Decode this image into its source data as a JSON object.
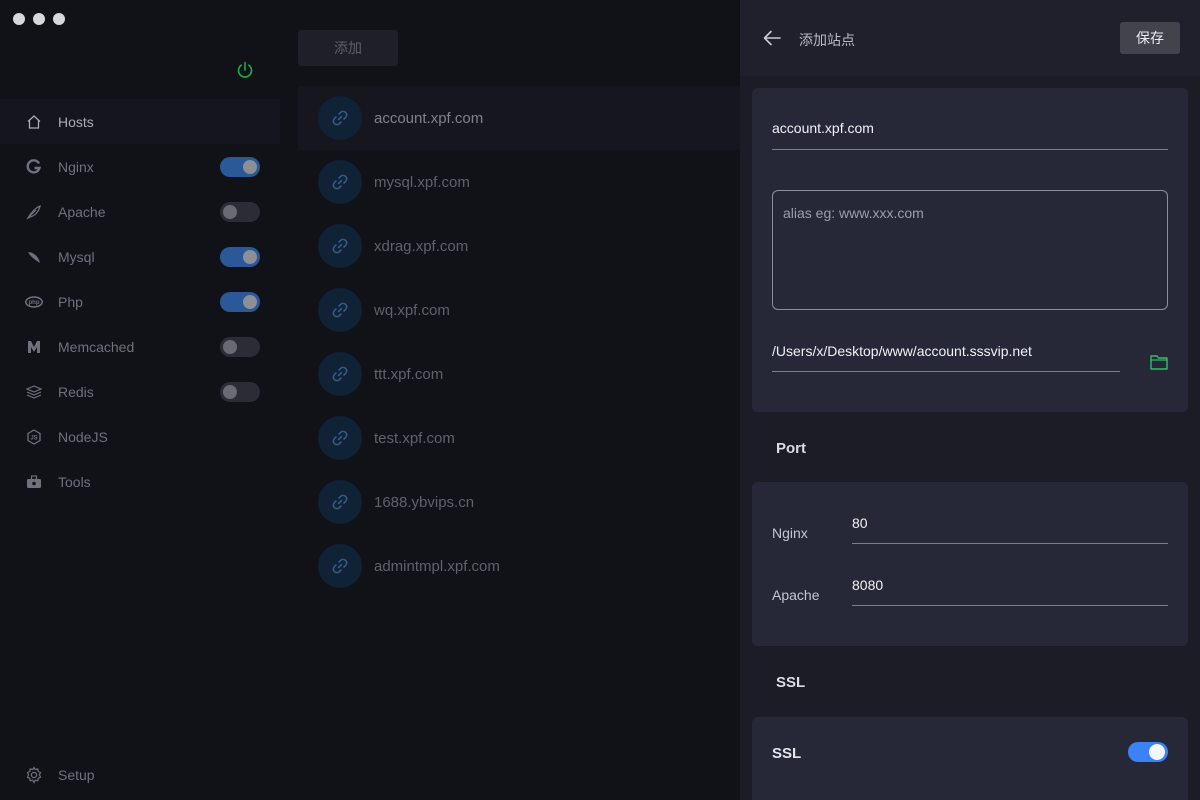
{
  "sidebar": {
    "items": [
      {
        "label": "Hosts",
        "icon": "home-icon",
        "toggle": null,
        "active": true
      },
      {
        "label": "Nginx",
        "icon": "nginx-icon",
        "toggle": true
      },
      {
        "label": "Apache",
        "icon": "feather-icon",
        "toggle": false
      },
      {
        "label": "Mysql",
        "icon": "dolphin-icon",
        "toggle": true
      },
      {
        "label": "Php",
        "icon": "php-icon",
        "toggle": true
      },
      {
        "label": "Memcached",
        "icon": "memcached-icon",
        "toggle": false
      },
      {
        "label": "Redis",
        "icon": "redis-icon",
        "toggle": false
      },
      {
        "label": "NodeJS",
        "icon": "nodejs-icon",
        "toggle": null
      },
      {
        "label": "Tools",
        "icon": "toolbox-icon",
        "toggle": null
      }
    ],
    "setup_label": "Setup"
  },
  "hosts": {
    "add_label": "添加",
    "items": [
      "account.xpf.com",
      "mysql.xpf.com",
      "xdrag.xpf.com",
      "wq.xpf.com",
      "ttt.xpf.com",
      "test.xpf.com",
      "1688.ybvips.cn",
      "admintmpl.xpf.com"
    ]
  },
  "panel": {
    "title": "添加站点",
    "save_label": "保存",
    "domain_value": "account.xpf.com",
    "alias_placeholder": "alias eg: www.xxx.com",
    "path_value": "/Users/x/Desktop/www/account.sssvip.net",
    "port_section": "Port",
    "nginx_label": "Nginx",
    "nginx_port": "80",
    "apache_label": "Apache",
    "apache_port": "8080",
    "ssl_section": "SSL",
    "ssl_label": "SSL",
    "ssl_enabled": true
  },
  "colors": {
    "accent_blue": "#3a82f6",
    "power_green": "#22a94a",
    "folder_green": "#2fbf6a"
  }
}
